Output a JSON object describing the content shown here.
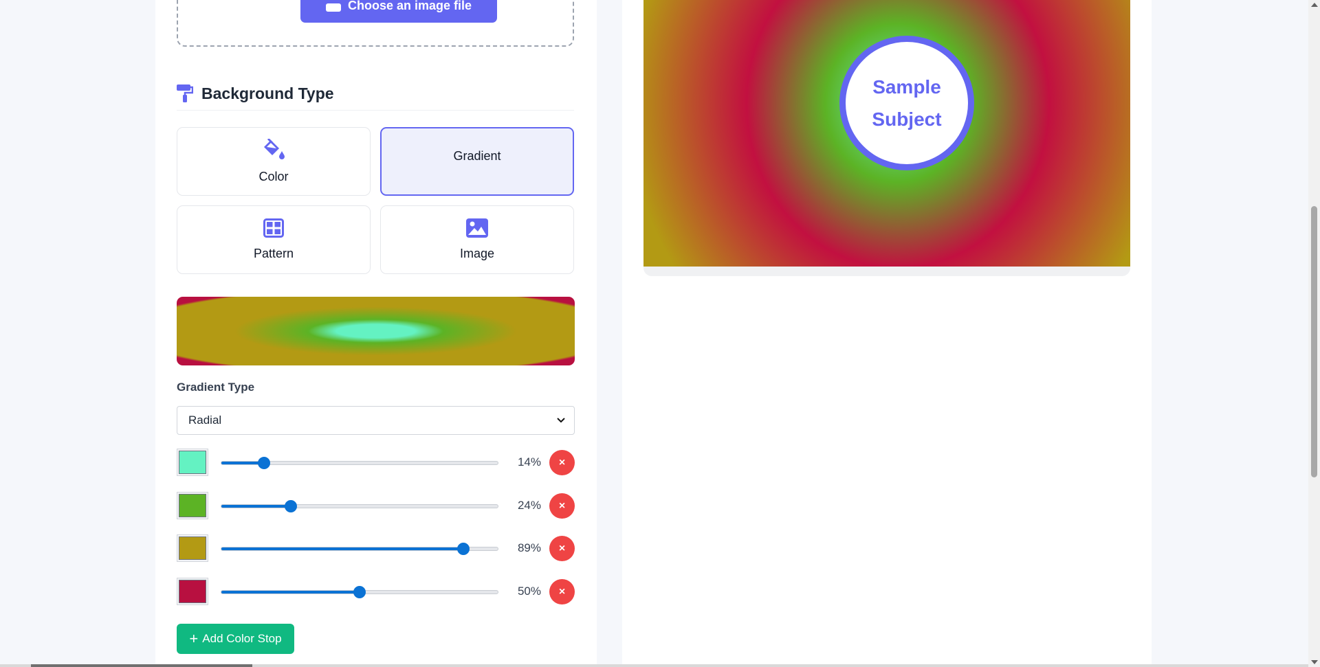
{
  "upload": {
    "button_label": "Choose an image file"
  },
  "background_section": {
    "title": "Background Type"
  },
  "bg_options": [
    {
      "label": "Color",
      "icon": "paint-bucket-icon",
      "active": false
    },
    {
      "label": "Gradient",
      "active": true
    },
    {
      "label": "Pattern",
      "icon": "grid-icon",
      "active": false
    },
    {
      "label": "Image",
      "icon": "image-icon",
      "active": false
    }
  ],
  "gradient": {
    "type_label": "Gradient Type",
    "type_value": "Radial",
    "stops": [
      {
        "color": "#64f2c2",
        "percent": 14,
        "label": "14%"
      },
      {
        "color": "#5cb325",
        "percent": 24,
        "label": "24%"
      },
      {
        "color": "#b39a14",
        "percent": 89,
        "label": "89%"
      },
      {
        "color": "#b81040",
        "percent": 50,
        "label": "50%"
      }
    ],
    "delete_symbol": "×",
    "add_stop_label": "Add Color Stop"
  },
  "preview": {
    "subject_line1": "Sample",
    "subject_line2": "Subject"
  },
  "colors": {
    "accent": "#6366f1",
    "danger": "#ef4444",
    "success": "#10b981",
    "slider": "#0b72d4"
  }
}
